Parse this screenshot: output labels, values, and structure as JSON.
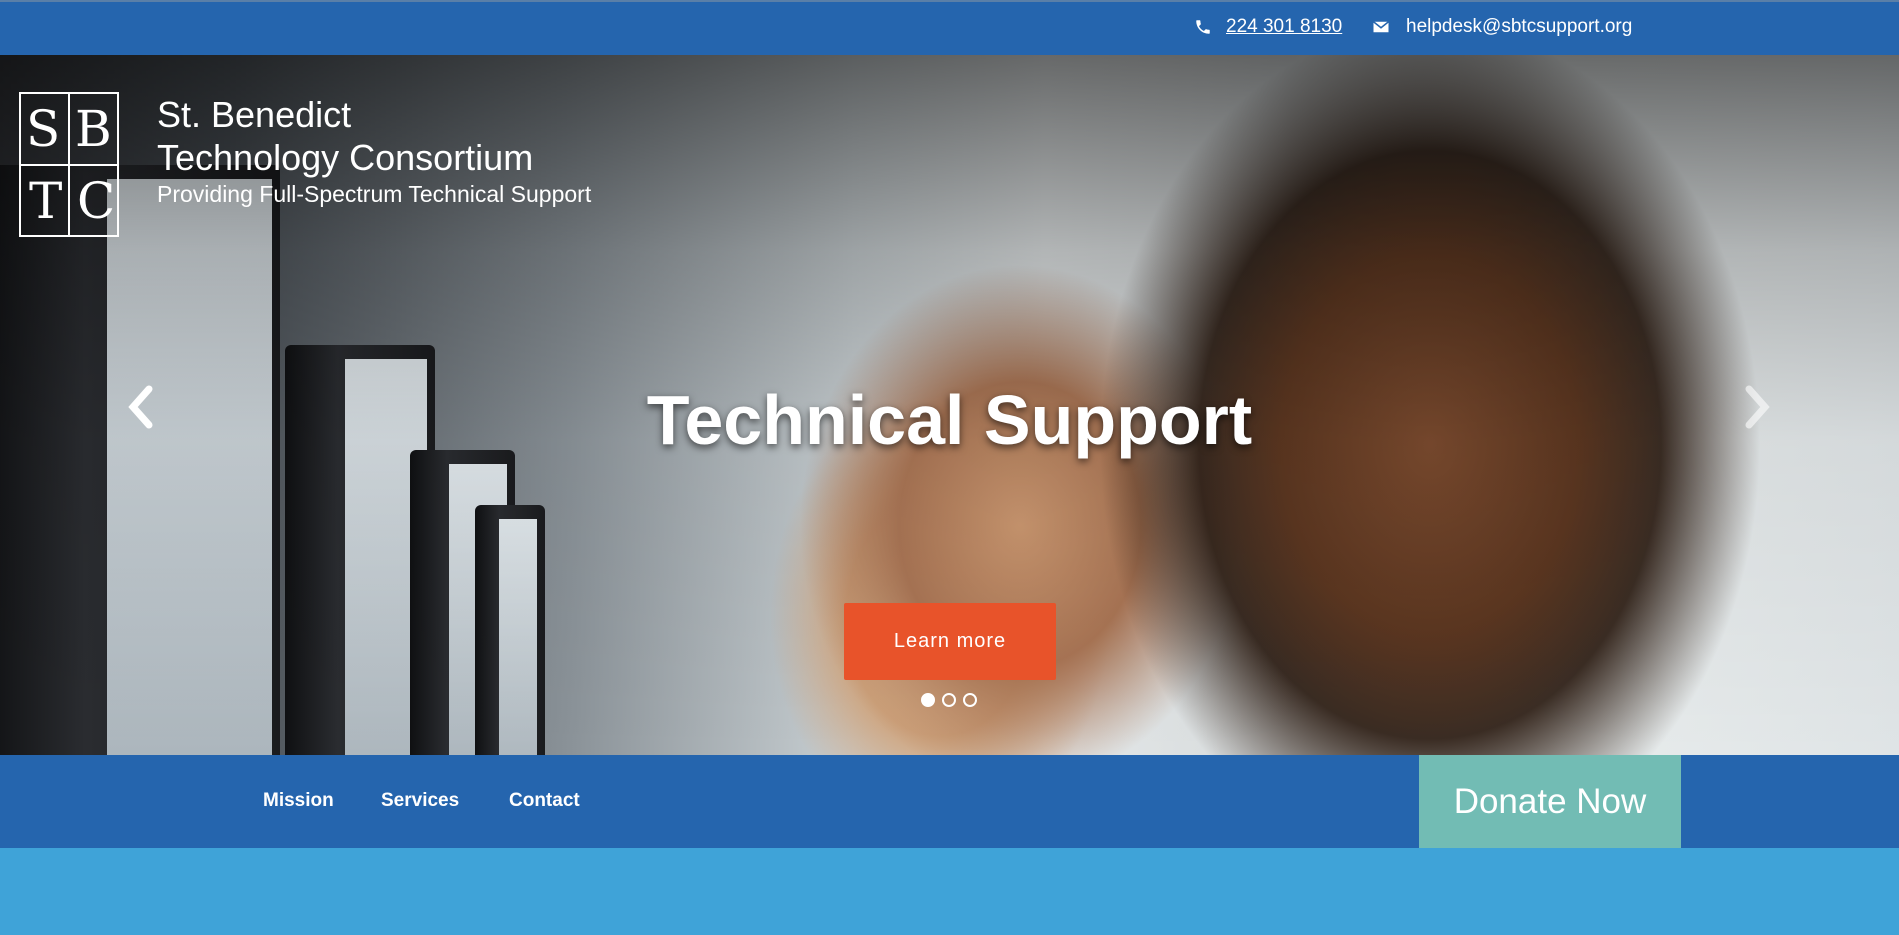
{
  "topbar": {
    "phone": "224 301 8130",
    "email": "helpdesk@sbtcsupport.org",
    "phone_icon": "phone-icon",
    "email_icon": "envelope-icon"
  },
  "logo": {
    "letters": [
      "S",
      "B",
      "T",
      "C"
    ]
  },
  "brand": {
    "line1": "St. Benedict",
    "line2": "Technology Consortium",
    "tagline": "Providing Full-Spectrum Technical Support"
  },
  "hero": {
    "headline": "Technical Support",
    "cta_label": "Learn more",
    "slides_total": 3,
    "active_slide": 1
  },
  "nav": {
    "items": [
      "Mission",
      "Services",
      "Contact"
    ],
    "donate_label": "Donate Now"
  },
  "colors": {
    "primary_blue": "#2565ae",
    "light_blue": "#3fa3d8",
    "cta_orange": "#e8532a",
    "donate_teal": "#72bcb4"
  }
}
